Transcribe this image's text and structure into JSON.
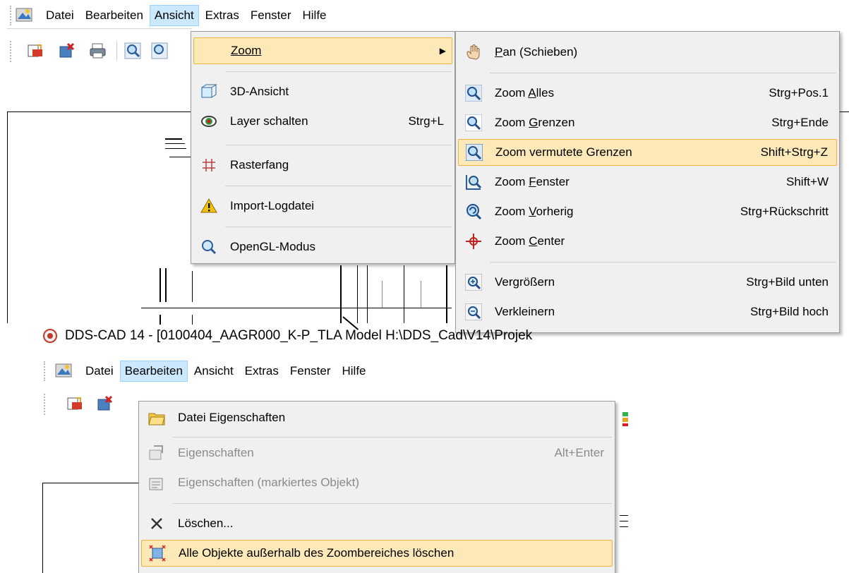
{
  "menubar": {
    "items": [
      "Datei",
      "Bearbeiten",
      "Ansicht",
      "Extras",
      "Fenster",
      "Hilfe"
    ]
  },
  "ansicht_menu": {
    "items": [
      {
        "label": "Zoom",
        "shortcut": "",
        "icon": "zoom-arrow-icon",
        "submenu": true
      },
      {
        "label": "3D-Ansicht",
        "shortcut": "",
        "icon": "3d-view-icon"
      },
      {
        "label": "Layer schalten",
        "shortcut": "Strg+L",
        "icon": "eye-icon"
      },
      {
        "label": "Rasterfang",
        "shortcut": "",
        "icon": "grid-icon"
      },
      {
        "label": "Import-Logdatei",
        "shortcut": "",
        "icon": "warning-icon"
      },
      {
        "label": "OpenGL-Modus",
        "shortcut": "",
        "icon": "magnifier-icon"
      }
    ]
  },
  "zoom_submenu": {
    "items": [
      {
        "pre": "",
        "acc": "P",
        "post": "an (Schieben)",
        "shortcut": "",
        "icon": "hand-icon"
      },
      {
        "pre": "Zoom ",
        "acc": "A",
        "post": "lles",
        "shortcut": "Strg+Pos.1",
        "icon": "zoom-all-icon"
      },
      {
        "pre": "Zoom ",
        "acc": "G",
        "post": "renzen",
        "shortcut": "Strg+Ende",
        "icon": "zoom-extents-icon"
      },
      {
        "pre": "Zoom vermutete Grenzen",
        "acc": "",
        "post": "",
        "shortcut": "Shift+Strg+Z",
        "icon": "zoom-assumed-icon"
      },
      {
        "pre": "Zoom ",
        "acc": "F",
        "post": "enster",
        "shortcut": "Shift+W",
        "icon": "zoom-window-icon"
      },
      {
        "pre": "Zoom ",
        "acc": "V",
        "post": "orherig",
        "shortcut": "Strg+Rückschritt",
        "icon": "zoom-previous-icon"
      },
      {
        "pre": "Zoom ",
        "acc": "C",
        "post": "enter",
        "shortcut": "",
        "icon": "zoom-center-icon"
      },
      {
        "pre": "Vergrößern",
        "acc": "",
        "post": "",
        "shortcut": "Strg+Bild unten",
        "icon": "zoom-in-icon"
      },
      {
        "pre": "Verkleinern",
        "acc": "",
        "post": "",
        "shortcut": "Strg+Bild hoch",
        "icon": "zoom-out-icon"
      }
    ]
  },
  "window_title": "DDS-CAD 14 - [0100404_AAGR000_K-P_TLA  Model  H:\\DDS_Cad\\V14\\Projek",
  "bearbeiten_menu": {
    "items": [
      {
        "label": "Datei Eigenschaften",
        "shortcut": "",
        "icon": "folder-icon",
        "disabled": false
      },
      {
        "label": "Eigenschaften",
        "shortcut": "Alt+Enter",
        "icon": "properties-icon",
        "disabled": true
      },
      {
        "label": "Eigenschaften (markiertes Objekt)",
        "shortcut": "",
        "icon": "properties-object-icon",
        "disabled": true
      },
      {
        "label": "Löschen...",
        "shortcut": "",
        "icon": "delete-icon",
        "disabled": false
      },
      {
        "label": "Alle Objekte außerhalb des Zoombereiches löschen",
        "shortcut": "",
        "icon": "delete-outside-zoom-icon",
        "disabled": false
      }
    ]
  },
  "colors": {
    "menu_bg": "#f0f0f0",
    "open_menubar_item": "#cce8ff",
    "highlight_bg": "#fde9b8",
    "highlight_border": "#f0b23e"
  }
}
